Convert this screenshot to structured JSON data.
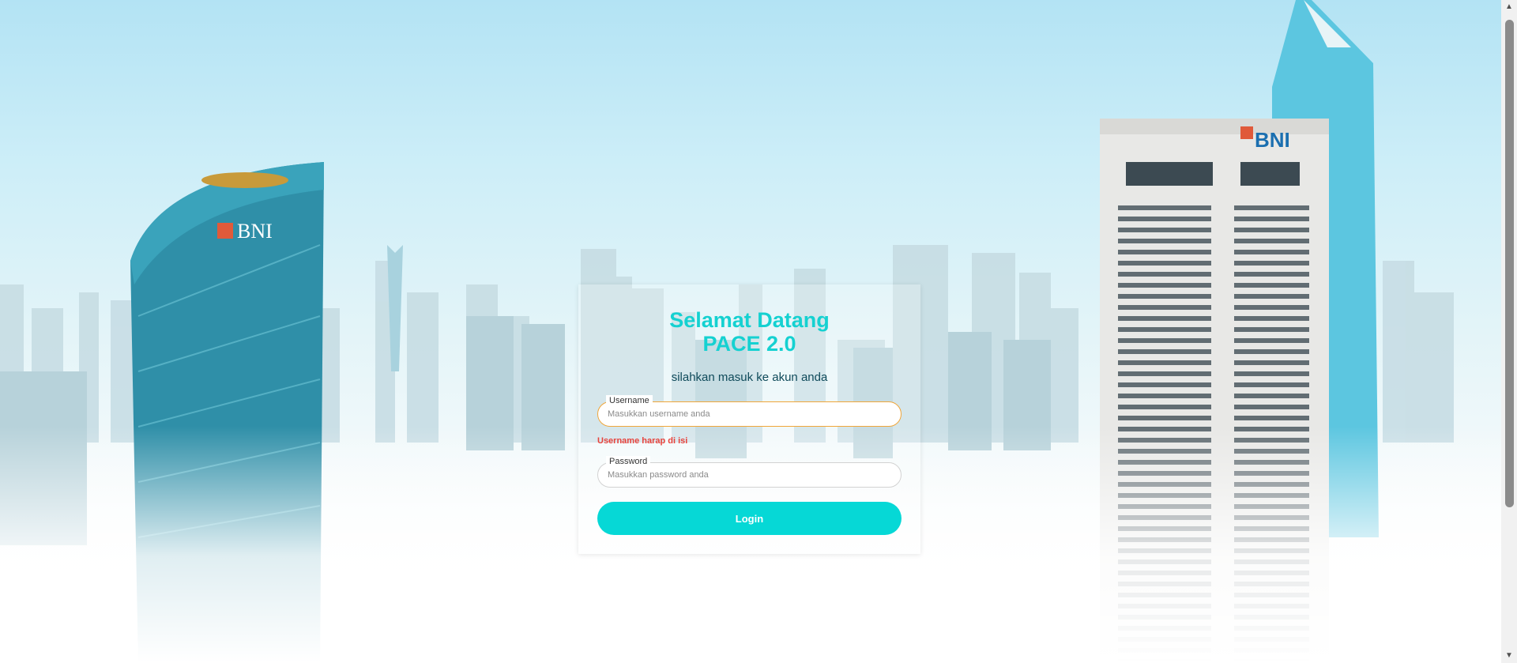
{
  "brand": {
    "logo_text": "BNI",
    "accent_color": "#06d8d6",
    "title_color": "#15d1d1",
    "error_color": "#e8433c"
  },
  "login": {
    "title_line1": "Selamat Datang",
    "title_line2": "PACE 2.0",
    "subtitle": "silahkan masuk ke akun anda",
    "username": {
      "label": "Username",
      "placeholder": "Masukkan username anda",
      "value": "",
      "error": "Username harap di isi"
    },
    "password": {
      "label": "Password",
      "placeholder": "Masukkan password anda",
      "value": ""
    },
    "login_button": "Login"
  },
  "scrollbar": {
    "up_icon": "chevron-up-icon",
    "down_icon": "chevron-down-icon"
  }
}
